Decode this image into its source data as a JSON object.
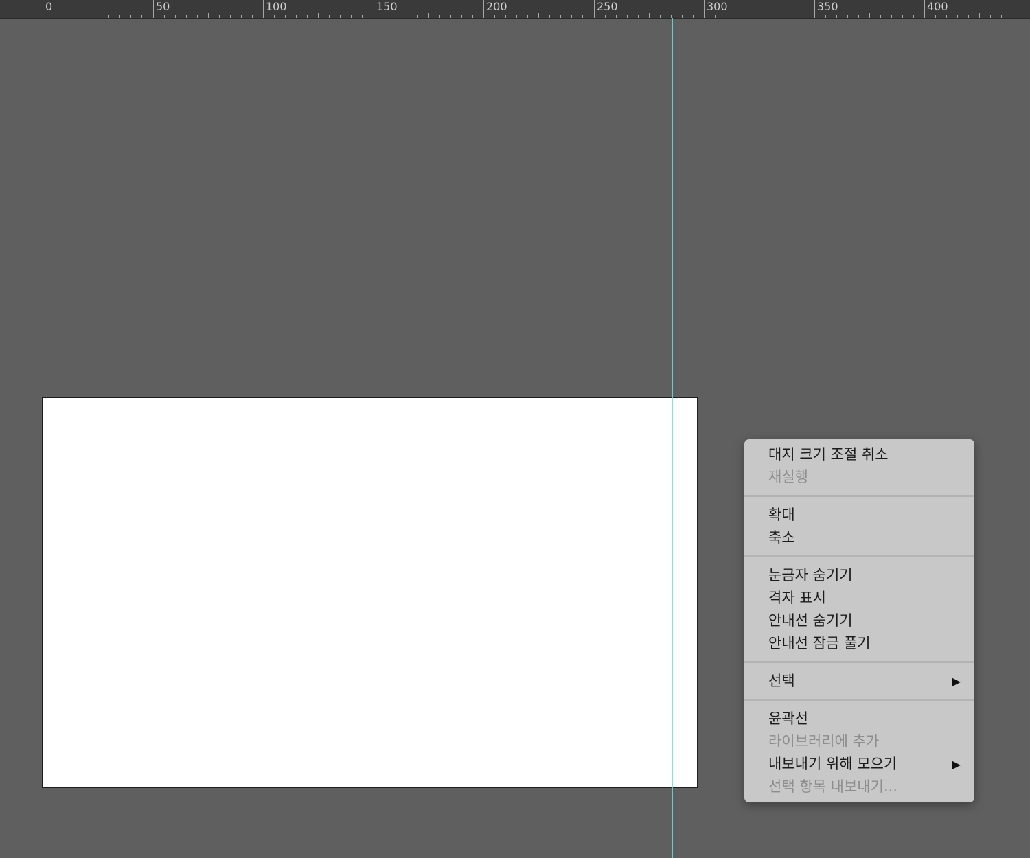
{
  "ruler": {
    "labels": [
      "0",
      "50",
      "100",
      "150",
      "200",
      "250",
      "300",
      "350",
      "400"
    ]
  },
  "colors": {
    "canvas_background": "#5f5f5f",
    "ruler_background": "#3a3a3a",
    "artboard_fill": "#ffffff",
    "guide_line": "#63dfe3",
    "menu_background": "#c8c8c8",
    "menu_text": "#1b1b1b",
    "menu_disabled_text": "#8d8d8d"
  },
  "context_menu": {
    "groups": [
      {
        "items": [
          {
            "label": "대지 크기 조절 취소",
            "enabled": true
          },
          {
            "label": "재실행",
            "enabled": false
          }
        ]
      },
      {
        "items": [
          {
            "label": "확대",
            "enabled": true
          },
          {
            "label": "축소",
            "enabled": true
          }
        ]
      },
      {
        "items": [
          {
            "label": "눈금자 숨기기",
            "enabled": true
          },
          {
            "label": "격자 표시",
            "enabled": true
          },
          {
            "label": "안내선 숨기기",
            "enabled": true
          },
          {
            "label": "안내선 잠금 풀기",
            "enabled": true
          }
        ]
      },
      {
        "items": [
          {
            "label": "선택",
            "enabled": true,
            "submenu": true
          }
        ]
      },
      {
        "items": [
          {
            "label": "윤곽선",
            "enabled": true
          },
          {
            "label": "라이브러리에 추가",
            "enabled": false
          },
          {
            "label": "내보내기 위해 모으기",
            "enabled": true,
            "submenu": true
          },
          {
            "label": "선택 항목 내보내기...",
            "enabled": false
          }
        ]
      }
    ],
    "submenu_arrow": "▶"
  }
}
